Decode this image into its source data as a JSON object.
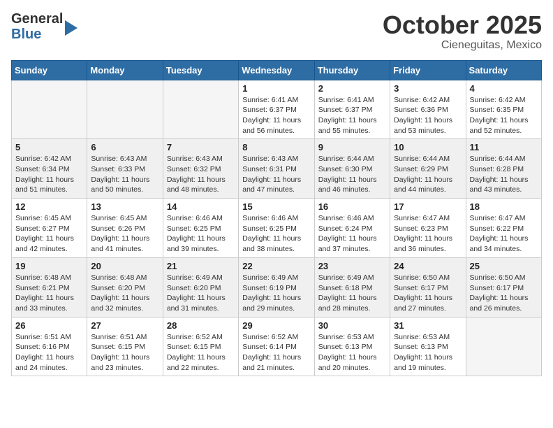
{
  "header": {
    "logo_general": "General",
    "logo_blue": "Blue",
    "month_title": "October 2025",
    "location": "Cieneguitas, Mexico"
  },
  "weekdays": [
    "Sunday",
    "Monday",
    "Tuesday",
    "Wednesday",
    "Thursday",
    "Friday",
    "Saturday"
  ],
  "weeks": [
    [
      {
        "day": "",
        "info": ""
      },
      {
        "day": "",
        "info": ""
      },
      {
        "day": "",
        "info": ""
      },
      {
        "day": "1",
        "info": "Sunrise: 6:41 AM\nSunset: 6:37 PM\nDaylight: 11 hours\nand 56 minutes."
      },
      {
        "day": "2",
        "info": "Sunrise: 6:41 AM\nSunset: 6:37 PM\nDaylight: 11 hours\nand 55 minutes."
      },
      {
        "day": "3",
        "info": "Sunrise: 6:42 AM\nSunset: 6:36 PM\nDaylight: 11 hours\nand 53 minutes."
      },
      {
        "day": "4",
        "info": "Sunrise: 6:42 AM\nSunset: 6:35 PM\nDaylight: 11 hours\nand 52 minutes."
      }
    ],
    [
      {
        "day": "5",
        "info": "Sunrise: 6:42 AM\nSunset: 6:34 PM\nDaylight: 11 hours\nand 51 minutes."
      },
      {
        "day": "6",
        "info": "Sunrise: 6:43 AM\nSunset: 6:33 PM\nDaylight: 11 hours\nand 50 minutes."
      },
      {
        "day": "7",
        "info": "Sunrise: 6:43 AM\nSunset: 6:32 PM\nDaylight: 11 hours\nand 48 minutes."
      },
      {
        "day": "8",
        "info": "Sunrise: 6:43 AM\nSunset: 6:31 PM\nDaylight: 11 hours\nand 47 minutes."
      },
      {
        "day": "9",
        "info": "Sunrise: 6:44 AM\nSunset: 6:30 PM\nDaylight: 11 hours\nand 46 minutes."
      },
      {
        "day": "10",
        "info": "Sunrise: 6:44 AM\nSunset: 6:29 PM\nDaylight: 11 hours\nand 44 minutes."
      },
      {
        "day": "11",
        "info": "Sunrise: 6:44 AM\nSunset: 6:28 PM\nDaylight: 11 hours\nand 43 minutes."
      }
    ],
    [
      {
        "day": "12",
        "info": "Sunrise: 6:45 AM\nSunset: 6:27 PM\nDaylight: 11 hours\nand 42 minutes."
      },
      {
        "day": "13",
        "info": "Sunrise: 6:45 AM\nSunset: 6:26 PM\nDaylight: 11 hours\nand 41 minutes."
      },
      {
        "day": "14",
        "info": "Sunrise: 6:46 AM\nSunset: 6:25 PM\nDaylight: 11 hours\nand 39 minutes."
      },
      {
        "day": "15",
        "info": "Sunrise: 6:46 AM\nSunset: 6:25 PM\nDaylight: 11 hours\nand 38 minutes."
      },
      {
        "day": "16",
        "info": "Sunrise: 6:46 AM\nSunset: 6:24 PM\nDaylight: 11 hours\nand 37 minutes."
      },
      {
        "day": "17",
        "info": "Sunrise: 6:47 AM\nSunset: 6:23 PM\nDaylight: 11 hours\nand 36 minutes."
      },
      {
        "day": "18",
        "info": "Sunrise: 6:47 AM\nSunset: 6:22 PM\nDaylight: 11 hours\nand 34 minutes."
      }
    ],
    [
      {
        "day": "19",
        "info": "Sunrise: 6:48 AM\nSunset: 6:21 PM\nDaylight: 11 hours\nand 33 minutes."
      },
      {
        "day": "20",
        "info": "Sunrise: 6:48 AM\nSunset: 6:20 PM\nDaylight: 11 hours\nand 32 minutes."
      },
      {
        "day": "21",
        "info": "Sunrise: 6:49 AM\nSunset: 6:20 PM\nDaylight: 11 hours\nand 31 minutes."
      },
      {
        "day": "22",
        "info": "Sunrise: 6:49 AM\nSunset: 6:19 PM\nDaylight: 11 hours\nand 29 minutes."
      },
      {
        "day": "23",
        "info": "Sunrise: 6:49 AM\nSunset: 6:18 PM\nDaylight: 11 hours\nand 28 minutes."
      },
      {
        "day": "24",
        "info": "Sunrise: 6:50 AM\nSunset: 6:17 PM\nDaylight: 11 hours\nand 27 minutes."
      },
      {
        "day": "25",
        "info": "Sunrise: 6:50 AM\nSunset: 6:17 PM\nDaylight: 11 hours\nand 26 minutes."
      }
    ],
    [
      {
        "day": "26",
        "info": "Sunrise: 6:51 AM\nSunset: 6:16 PM\nDaylight: 11 hours\nand 24 minutes."
      },
      {
        "day": "27",
        "info": "Sunrise: 6:51 AM\nSunset: 6:15 PM\nDaylight: 11 hours\nand 23 minutes."
      },
      {
        "day": "28",
        "info": "Sunrise: 6:52 AM\nSunset: 6:15 PM\nDaylight: 11 hours\nand 22 minutes."
      },
      {
        "day": "29",
        "info": "Sunrise: 6:52 AM\nSunset: 6:14 PM\nDaylight: 11 hours\nand 21 minutes."
      },
      {
        "day": "30",
        "info": "Sunrise: 6:53 AM\nSunset: 6:13 PM\nDaylight: 11 hours\nand 20 minutes."
      },
      {
        "day": "31",
        "info": "Sunrise: 6:53 AM\nSunset: 6:13 PM\nDaylight: 11 hours\nand 19 minutes."
      },
      {
        "day": "",
        "info": ""
      }
    ]
  ]
}
